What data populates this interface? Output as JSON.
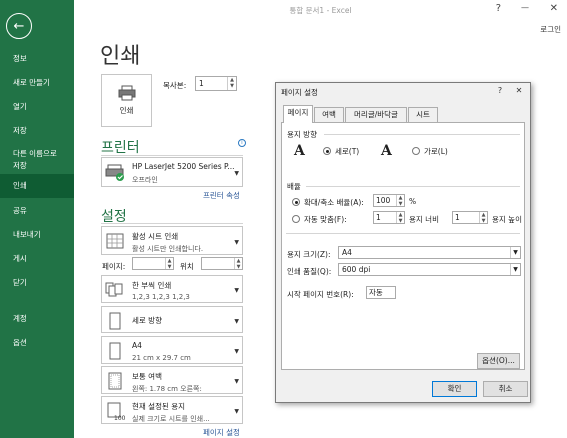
{
  "window": {
    "title": "통합 문서1 - Excel",
    "login": "로그인",
    "help_glyph": "?",
    "minimize_glyph": "—",
    "close_glyph": "✕"
  },
  "sidebar": {
    "back_glyph": "←",
    "items": [
      {
        "label": "정보"
      },
      {
        "label": "새로 만들기"
      },
      {
        "label": "열기"
      },
      {
        "label": "저장"
      },
      {
        "label": "다른 이름으로\n저장"
      },
      {
        "label": "인쇄",
        "active": true
      },
      {
        "label": "공유"
      },
      {
        "label": "내보내기"
      },
      {
        "label": "게시"
      },
      {
        "label": "닫기"
      },
      {
        "label": "계정"
      },
      {
        "label": "옵션"
      }
    ]
  },
  "print": {
    "title": "인쇄",
    "print_button": "인쇄",
    "copies_label": "복사본:",
    "copies_value": "1",
    "printer_heading": "프린터",
    "printer_name": "HP LaserJet 5200 Series P...",
    "printer_status": "오프라인",
    "printer_props": "프린터 속성",
    "settings_heading": "설정",
    "settings": {
      "scope_main": "활성 시트 인쇄",
      "scope_sub": "활성 시트만 인쇄합니다.",
      "pages_label": "페이지:",
      "pages_to": "위치",
      "collate_main": "한 부씩 인쇄",
      "collate_sub": "1,2,3    1,2,3    1,2,3",
      "orientation": "세로 방향",
      "paper_main": "A4",
      "paper_sub": "21 cm x 29.7 cm",
      "margins_main": "보통 여백",
      "margins_sub": "왼쪽:  1.78 cm    오른쪽:",
      "scaling_main": "현재 설정된 용지",
      "scaling_sub": "실제 크기로 시트를 인쇄...",
      "page_setup_link": "페이지 설정"
    }
  },
  "dialog": {
    "title": "페이지 설정",
    "help": "?",
    "close": "✕",
    "tabs": [
      "페이지",
      "여백",
      "머리글/바닥글",
      "시트"
    ],
    "orientation_group": "용지 방향",
    "portrait": "세로(T)",
    "landscape": "가로(L)",
    "orientation_glyph": "A",
    "scale_group": "배율",
    "adjust_label": "확대/축소 배율(A):",
    "adjust_value": "100",
    "adjust_unit": "%",
    "fit_label": "자동 맞춤(F):",
    "fit_wide": "1",
    "fit_wide_label": "용지 너비",
    "fit_tall": "1",
    "fit_tall_label": "용지 높이",
    "paper_size_label": "용지 크기(Z):",
    "paper_size": "A4",
    "print_quality_label": "인쇄 품질(Q):",
    "print_quality": "600 dpi",
    "first_page_label": "시작 페이지 번호(R):",
    "first_page": "자동",
    "options_button": "옵션(O)...",
    "ok_button": "확인",
    "cancel_button": "취소"
  },
  "colors": {
    "accent": "#217346",
    "sidebar_active": "#0f5c33",
    "link": "#2b5797"
  }
}
